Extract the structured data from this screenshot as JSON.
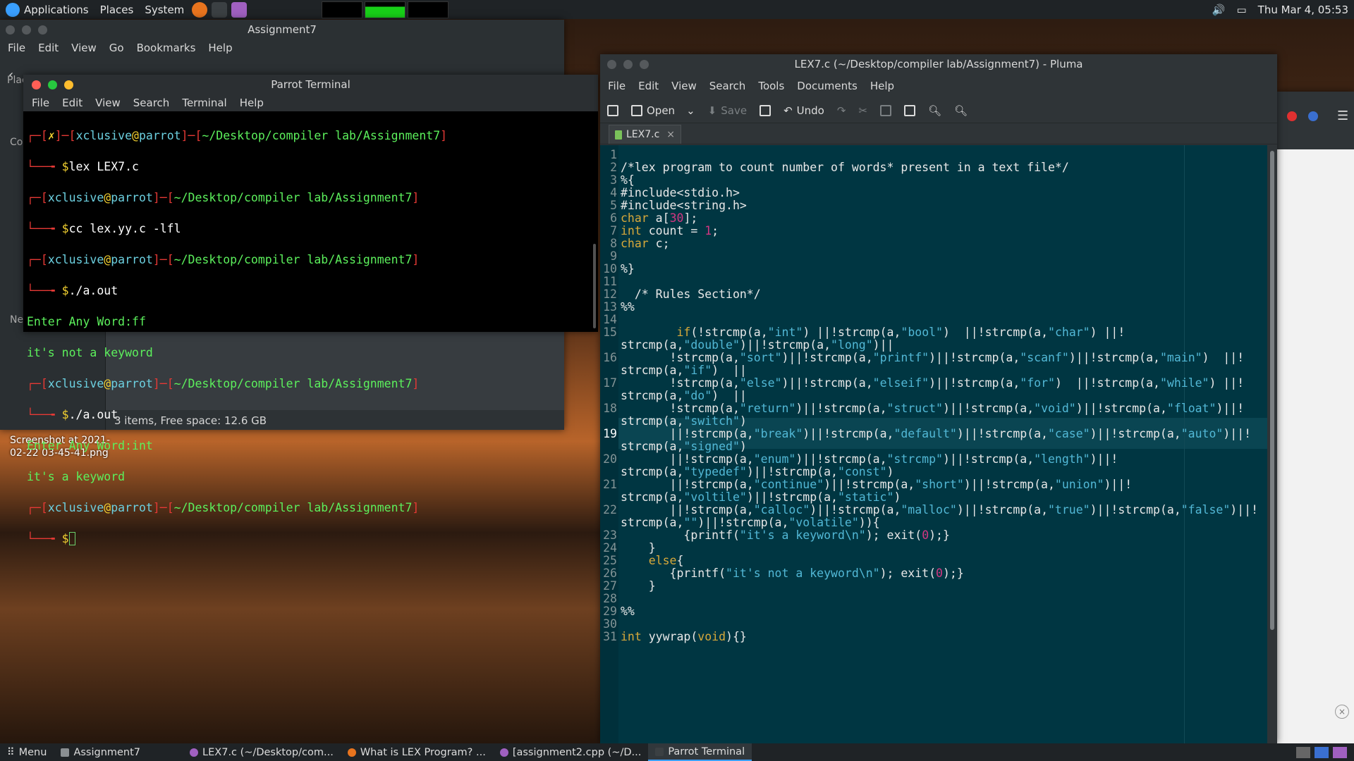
{
  "top_panel": {
    "applications": "Applications",
    "places": "Places",
    "system": "System",
    "clock": "Thu Mar  4, 05:53"
  },
  "file_manager": {
    "title": "Assignment7",
    "menu": [
      "File",
      "Edit",
      "View",
      "Go",
      "Bookmarks",
      "Help"
    ],
    "status": "3 items, Free space: 12.6 GB",
    "side_visible": [
      "Plac",
      "Con",
      "Net"
    ]
  },
  "terminal": {
    "title": "Parrot Terminal",
    "menu": [
      "File",
      "Edit",
      "View",
      "Search",
      "Terminal",
      "Help"
    ],
    "user": "xclusive",
    "host": "parrot",
    "path": "~/Desktop/compiler lab/Assignment7",
    "fail_mark": "✗",
    "commands": [
      "lex LEX7.c",
      "cc lex.yy.c -lfl",
      "./a.out",
      "./a.out"
    ],
    "outputs": [
      [
        "Enter Any Word:ff",
        "it's not a keyword"
      ],
      [
        "Enter Any Word:int",
        "it's a keyword"
      ]
    ]
  },
  "pluma": {
    "title": "LEX7.c (~/Desktop/compiler lab/Assignment7) - Pluma",
    "menu": [
      "File",
      "Edit",
      "View",
      "Search",
      "Tools",
      "Documents",
      "Help"
    ],
    "toolbar": {
      "open": "Open",
      "save": "Save",
      "undo": "Undo"
    },
    "tab": "LEX7.c",
    "current_line": 19
  },
  "desktop_icon": {
    "label_1": "Screenshot at 2021-",
    "label_2": "02-22 03-45-41.png"
  },
  "taskbar": {
    "menu": "Menu",
    "tasks": [
      "Assignment7",
      "LEX7.c (~/Desktop/com...",
      "What is LEX Program? ...",
      "[assignment2.cpp (~/D...",
      "Parrot Terminal"
    ]
  },
  "colors": {
    "editor_bg": "#003642",
    "terminal_prompt_red": "#e53935",
    "terminal_green": "#5cf05c",
    "keyword": "#d8a93a",
    "string": "#52b8d6"
  }
}
